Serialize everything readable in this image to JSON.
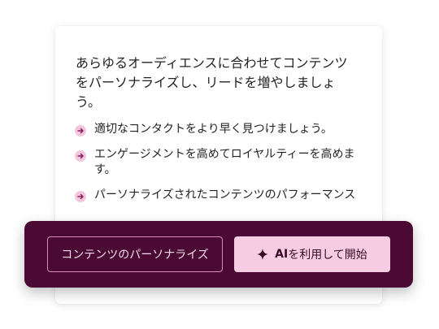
{
  "card": {
    "intro": "あらゆるオーディエンスに合わせてコンテンツをパーソナライズし、リードを増やしましょう。",
    "bullets": [
      {
        "icon": "arrow-right-icon",
        "text": "適切なコンタクトをより早く見つけましょう。"
      },
      {
        "icon": "arrow-right-icon",
        "text": "エンゲージメントを高めてロイヤルティーを高めます。"
      },
      {
        "icon": "arrow-right-icon",
        "text": "パーソナライズされたコンテンツのパフォーマンス"
      }
    ]
  },
  "actions": {
    "personalize_label": "コンテンツのパーソナライズ",
    "ai_start_ai": "AI",
    "ai_start_rest": "を利用して開始",
    "ai_icon": "sparkle-icon"
  },
  "colors": {
    "bar_bg": "#4a0a33",
    "primary_bg": "#f6cce2",
    "bullet_bg": "#f4c6de",
    "bullet_arrow": "#8a1d5b"
  }
}
